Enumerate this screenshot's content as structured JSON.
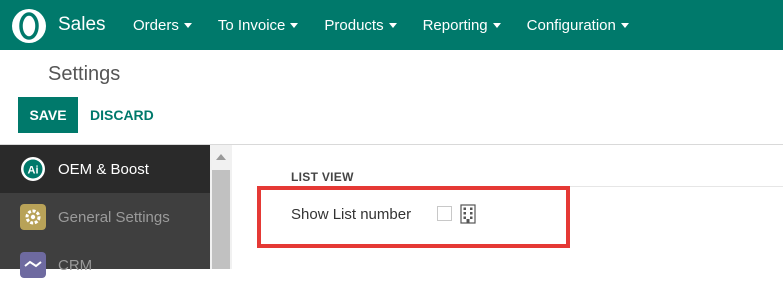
{
  "navbar": {
    "logo_icon": "odoo-o-logo",
    "app_name": "Sales",
    "menu": [
      {
        "label": "Orders"
      },
      {
        "label": "To Invoice"
      },
      {
        "label": "Products"
      },
      {
        "label": "Reporting"
      },
      {
        "label": "Configuration"
      }
    ],
    "bg_color": "#00796b"
  },
  "control_panel": {
    "breadcrumb": "Settings",
    "save_label": "SAVE",
    "discard_label": "DISCARD"
  },
  "sidebar": {
    "items": [
      {
        "label": "OEM & Boost",
        "icon": "oem-boost-icon",
        "active": true
      },
      {
        "label": "General Settings",
        "icon": "gear-icon",
        "active": false
      },
      {
        "label": "CRM",
        "icon": "handshake-icon",
        "active": false
      }
    ]
  },
  "content": {
    "section_title": "LIST VIEW",
    "field_label": "Show List number",
    "checkbox_checked": false,
    "company_icon": "building-icon",
    "highlight_color": "#e53935"
  }
}
